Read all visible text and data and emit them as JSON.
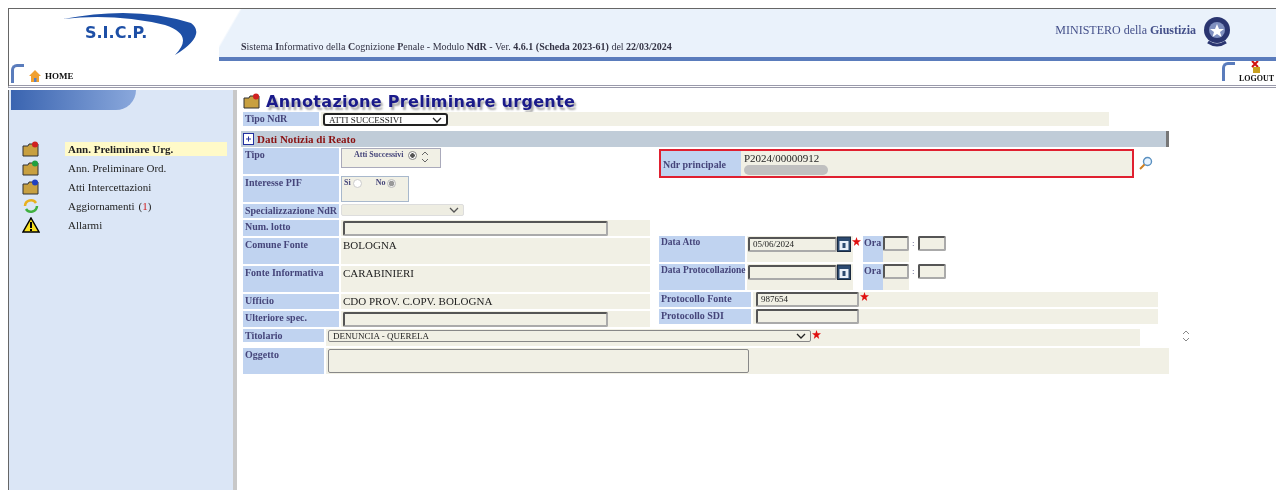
{
  "header": {
    "logo": "S.I.C.P.",
    "subtitle": "**S**istema **I**nformativo della **C**ognizione **P**enale - Modulo **NdR** - Ver. **4.6.1 (Scheda 2023-61)** del **22/03/2024**",
    "ministry": "MINISTERO della **Giustizia**"
  },
  "nav": {
    "home": "HOME",
    "logout": "LOGOUT"
  },
  "sidebar": {
    "items": [
      {
        "label": "Ann. Preliminare Urg.",
        "kind": "folder",
        "color": "#d02020",
        "selected": true
      },
      {
        "label": "Ann. Preliminare Ord.",
        "kind": "folder",
        "color": "#20a040",
        "selected": false
      },
      {
        "label": "Atti Intercettazioni",
        "kind": "folder",
        "color": "#2040c0",
        "selected": false
      },
      {
        "label": "Aggiornamenti",
        "kind": "refresh",
        "selected": false,
        "count": "1",
        "brackets": [
          "(",
          ")"
        ]
      },
      {
        "label": "Allarmi",
        "kind": "warning",
        "selected": false
      }
    ]
  },
  "page_title": "Annotazione Preliminare urgente",
  "tipo_ndr": {
    "label": "Tipo NdR",
    "value": "ATTI SUCCESSIVI"
  },
  "section": {
    "title": "Dati Notizia di Reato"
  },
  "left_fields": [
    {
      "kind": "spinner",
      "label": "Tipo",
      "value": "Atti Successivi",
      "checked": true
    },
    {
      "kind": "radio",
      "label": "Interesse PIF",
      "disabled": true,
      "options": [
        {
          "label": "Si",
          "selected": false
        },
        {
          "label": "No",
          "selected": true
        }
      ]
    },
    {
      "kind": "select",
      "label": "Specializzazione NdR",
      "disabled": true
    },
    {
      "kind": "input",
      "label": "Num. lotto"
    },
    {
      "kind": "text",
      "label": "Comune Fonte",
      "value": "BOLOGNA"
    },
    {
      "kind": "text",
      "label": "Fonte Informativa",
      "value": "CARABINIERI"
    },
    {
      "kind": "text",
      "label": "Ufficio",
      "value": "CDO PROV. C.OPV. BOLOGNA"
    },
    {
      "kind": "input",
      "label": "Ulteriore spec."
    }
  ],
  "ndr_principale": {
    "label": "Ndr principale",
    "value": "P2024/00000912",
    "highlighted": true
  },
  "right_fields": [
    {
      "kind": "date",
      "label": "Data Atto",
      "value": "05/06/2024",
      "required": true,
      "time_label": "Ora",
      "time_separator": ":"
    },
    {
      "kind": "date",
      "label": "Data Protocollazione",
      "required": false,
      "time_label": "Ora",
      "time_separator": ":"
    },
    {
      "kind": "input",
      "label": "Protocollo Fonte",
      "value": "987654",
      "required": true
    },
    {
      "kind": "input",
      "label": "Protocollo SDI",
      "required": false
    }
  ],
  "titolario": {
    "label": "Titolario",
    "value": "DENUNCIA - QUERELA",
    "required": true
  },
  "oggetto": {
    "label": "Oggetto"
  }
}
